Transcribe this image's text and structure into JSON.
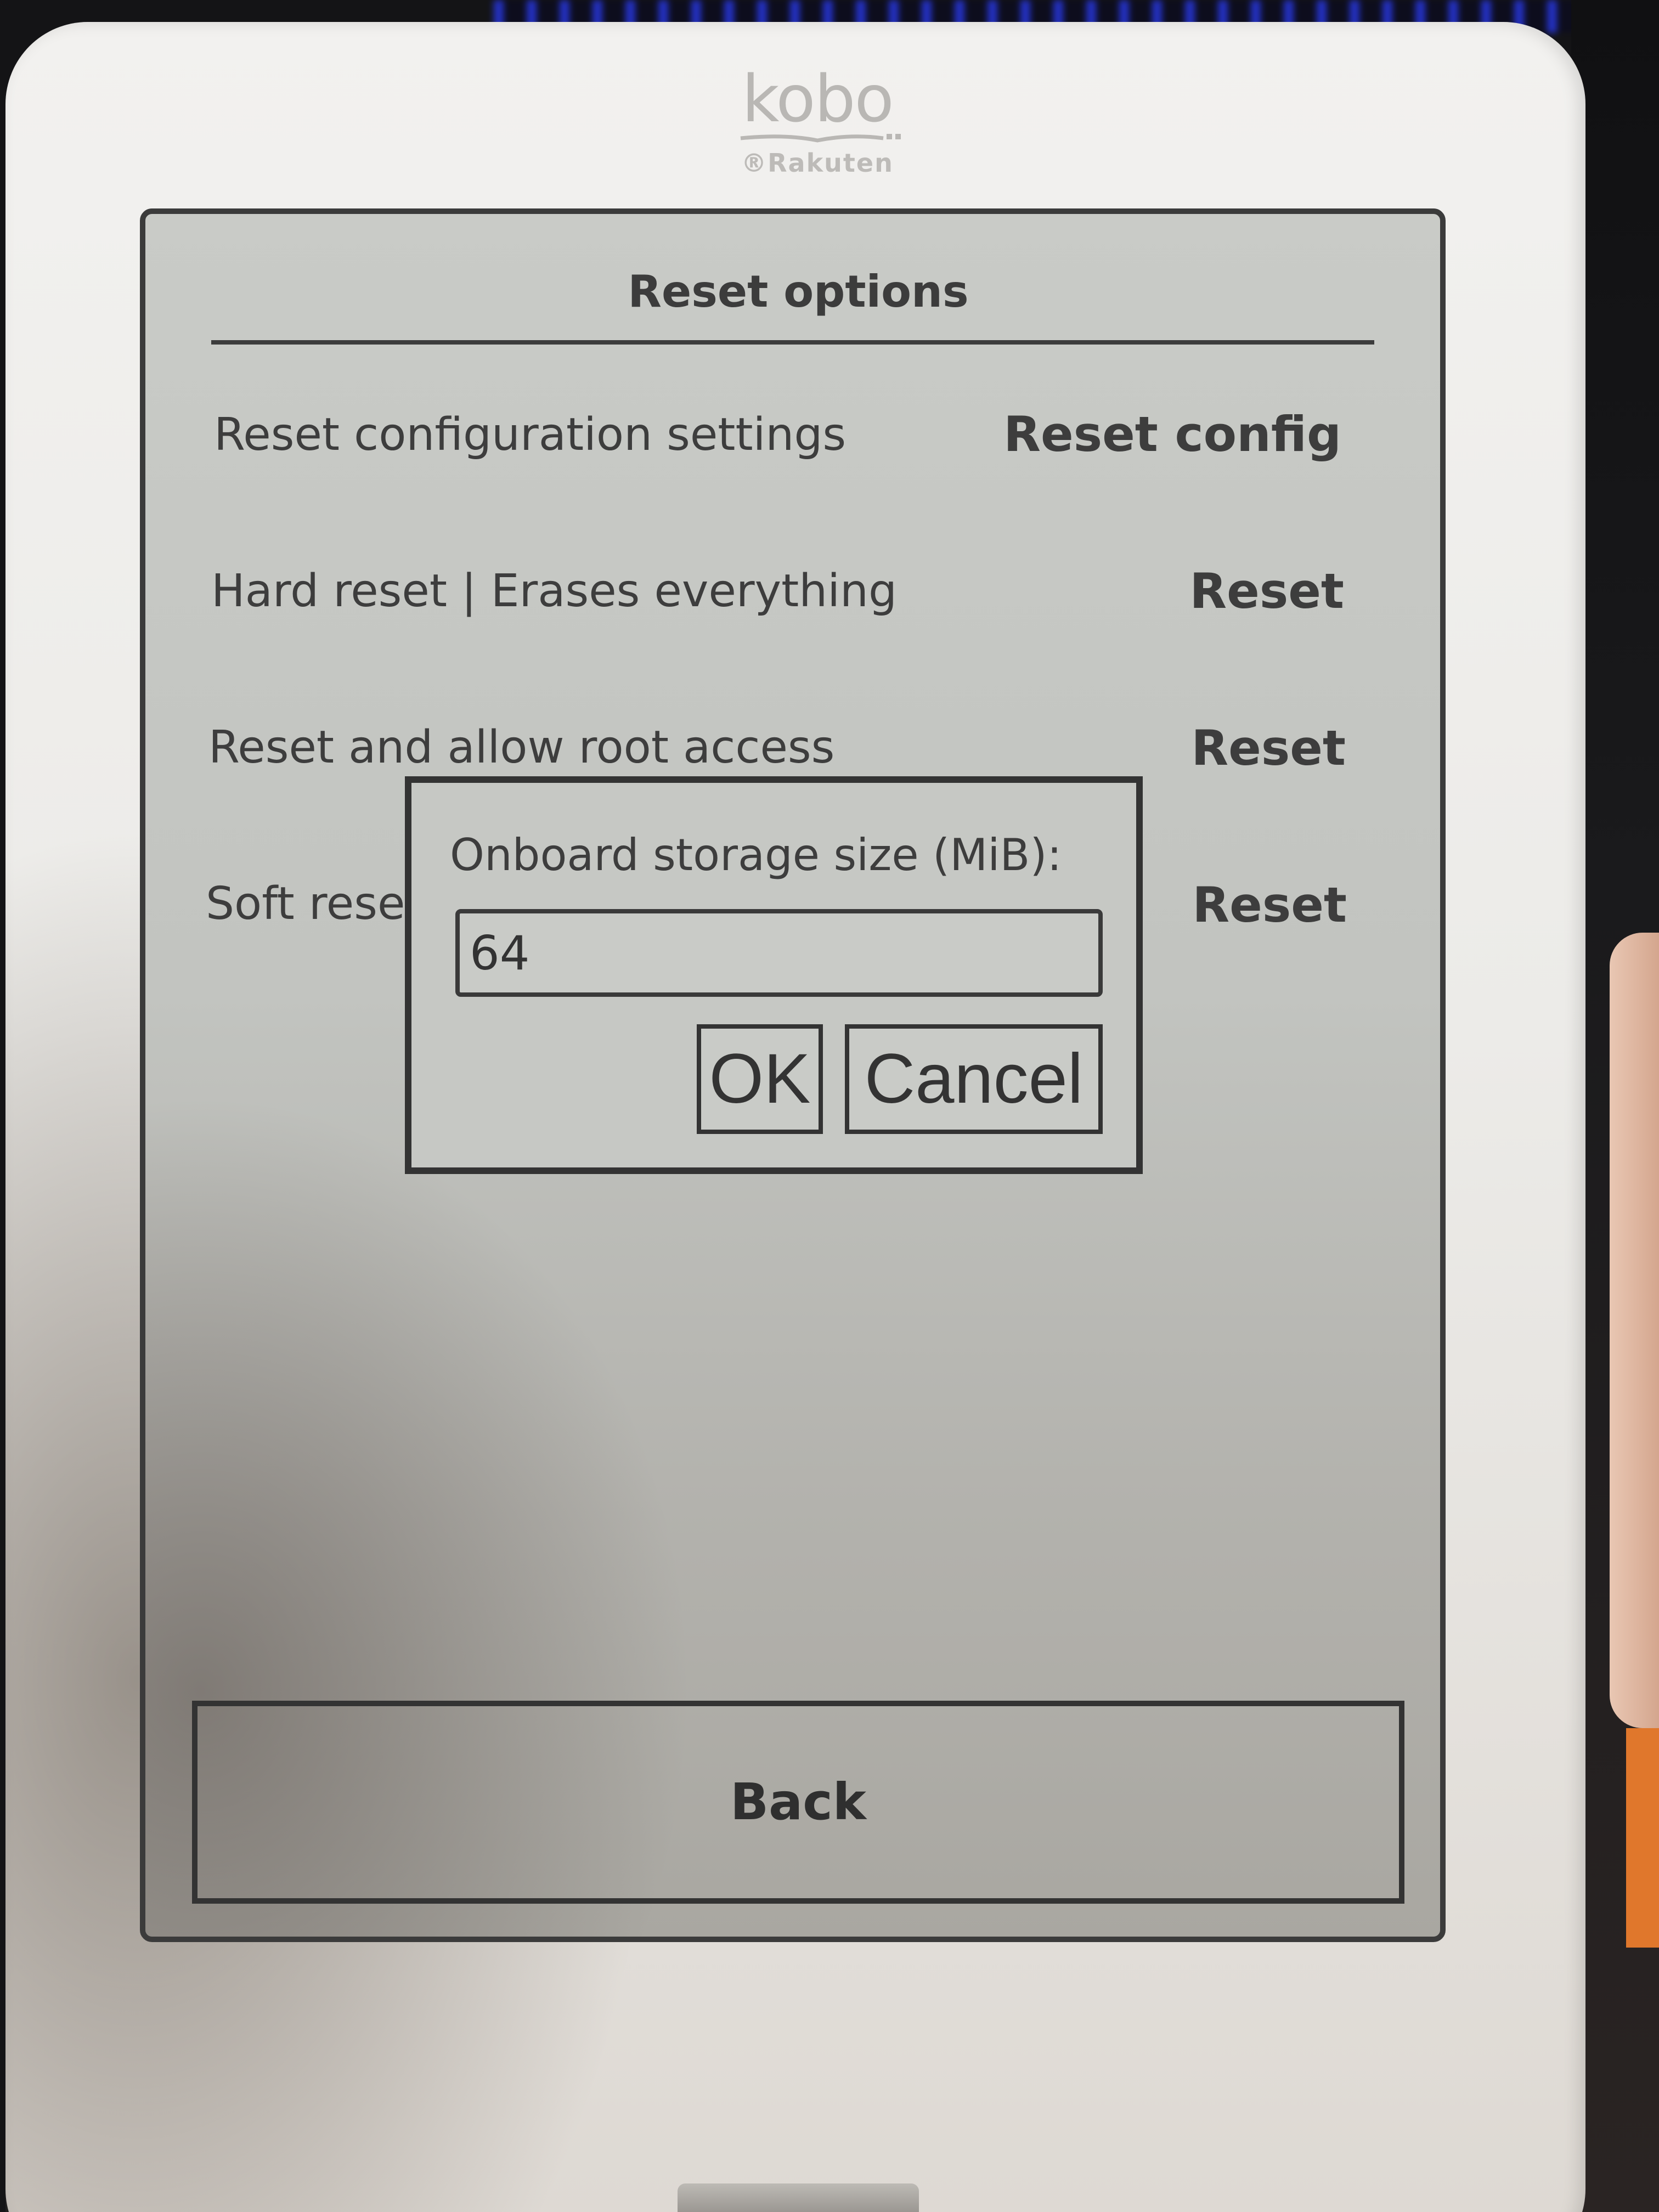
{
  "device": {
    "brand_logo": "kobo",
    "brand_sub": "®Rakuten"
  },
  "screen": {
    "title": "Reset options",
    "rows": [
      {
        "label": "Reset configuration settings",
        "action": "Reset config"
      },
      {
        "label": "Hard reset | Erases everything",
        "action": "Reset"
      },
      {
        "label": "Reset and allow root access",
        "action": "Reset"
      },
      {
        "label": "Soft rese",
        "action": "Reset"
      }
    ],
    "back_label": "Back"
  },
  "dialog": {
    "label": "Onboard storage size (MiB):",
    "input_value": "64",
    "ok_label": "OK",
    "cancel_label": "Cancel"
  }
}
